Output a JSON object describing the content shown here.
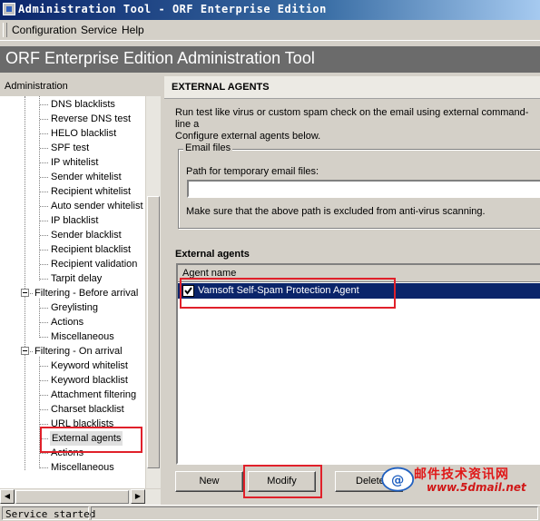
{
  "window": {
    "title": "Administration Tool - ORF Enterprise Edition"
  },
  "menu": {
    "items": [
      "Configuration",
      "Service",
      "Help"
    ]
  },
  "banner": {
    "title": "ORF Enterprise Edition Administration Tool"
  },
  "tree": {
    "header": "Administration",
    "items": {
      "dns_blacklists": "DNS blacklists",
      "reverse_dns_test": "Reverse DNS test",
      "helo_blacklist": "HELO blacklist",
      "spf_test": "SPF test",
      "ip_whitelist": "IP whitelist",
      "sender_whitelist": "Sender whitelist",
      "recipient_whitelist": "Recipient whitelist",
      "auto_sender_whitelist": "Auto sender whitelist",
      "ip_blacklist": "IP blacklist",
      "sender_blacklist": "Sender blacklist",
      "recipient_blacklist": "Recipient blacklist",
      "recipient_validation": "Recipient validation",
      "tarpit_delay": "Tarpit delay",
      "filtering_before": "Filtering - Before arrival",
      "greylisting": "Greylisting",
      "actions_1": "Actions",
      "miscellaneous_1": "Miscellaneous",
      "filtering_on": "Filtering - On arrival",
      "keyword_whitelist": "Keyword whitelist",
      "keyword_blacklist": "Keyword blacklist",
      "attachment_filtering": "Attachment filtering",
      "charset_blacklist": "Charset blacklist",
      "url_blacklists": "URL blacklists",
      "external_agents": "External agents",
      "actions_2": "Actions",
      "miscellaneous_2": "Miscellaneous"
    },
    "selected": "External agents"
  },
  "panel": {
    "header": "EXTERNAL AGENTS",
    "description": "Run test like virus or custom spam check on the email using external command-line a\nConfigure external agents below.",
    "email_files": {
      "group_label": "Email files",
      "path_label": "Path for temporary email files:",
      "path_value": "",
      "note": "Make sure that the above path is excluded from anti-virus scanning."
    },
    "agents": {
      "label": "External agents",
      "column_header": "Agent name",
      "rows": [
        {
          "name": "Vamsoft Self-Spam Protection Agent",
          "checked": true
        }
      ]
    },
    "buttons": {
      "new": "New",
      "modify": "Modify",
      "delete": "Delete"
    }
  },
  "watermark": {
    "text_cn": "邮件技术资讯网",
    "url": "www.5dmail.net"
  },
  "status": {
    "text": "Service started"
  },
  "colors": {
    "selection": "#0a246a",
    "highlight_box": "#e0202a",
    "banner": "#6b6b6b"
  }
}
